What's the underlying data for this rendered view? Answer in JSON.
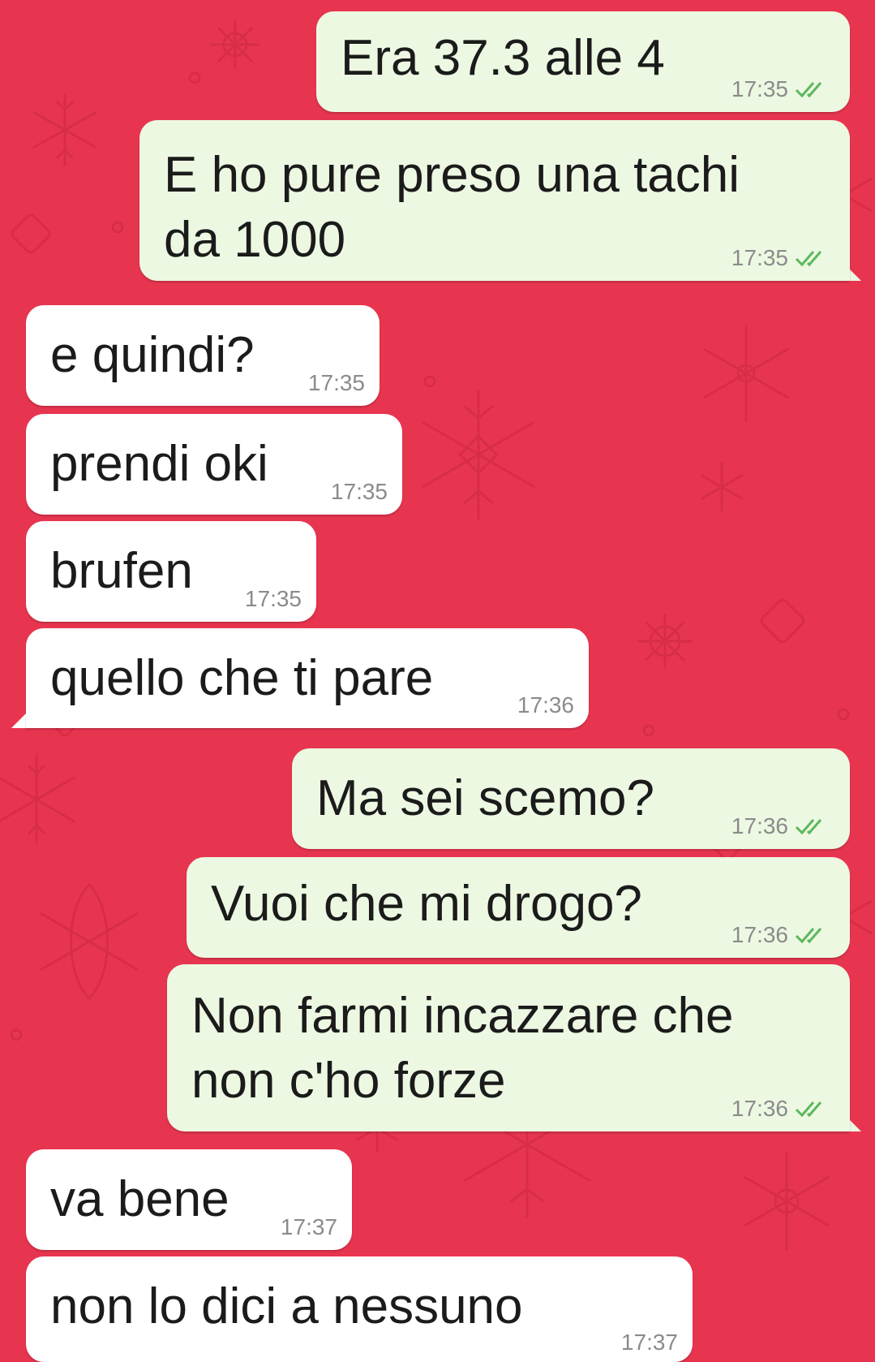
{
  "colors": {
    "chat_background": "#E8354F",
    "outgoing_bubble": "#EDF8E2",
    "incoming_bubble": "#FFFFFF",
    "read_checks": "#5CB85C",
    "timestamp": "#8B8B8B"
  },
  "wallpaper": {
    "pattern": "snowflake-doodles"
  },
  "messages": [
    {
      "direction": "out",
      "text": "Era 37.3 alle 4",
      "time": "17:35",
      "status": "read"
    },
    {
      "direction": "out",
      "text": "E ho pure preso una tachi\nda 1000",
      "time": "17:35",
      "status": "read"
    },
    {
      "direction": "in",
      "text": "e quindi?",
      "time": "17:35"
    },
    {
      "direction": "in",
      "text": "prendi oki",
      "time": "17:35"
    },
    {
      "direction": "in",
      "text": "brufen",
      "time": "17:35"
    },
    {
      "direction": "in",
      "text": "quello che ti pare",
      "time": "17:36"
    },
    {
      "direction": "out",
      "text": "Ma sei scemo?",
      "time": "17:36",
      "status": "read"
    },
    {
      "direction": "out",
      "text": "Vuoi che mi drogo?",
      "time": "17:36",
      "status": "read"
    },
    {
      "direction": "out",
      "text": "Non farmi incazzare che\nnon c'ho forze",
      "time": "17:36",
      "status": "read"
    },
    {
      "direction": "in",
      "text": "va bene",
      "time": "17:37"
    },
    {
      "direction": "in",
      "text": "non lo dici a nessuno",
      "time": "17:37"
    }
  ]
}
